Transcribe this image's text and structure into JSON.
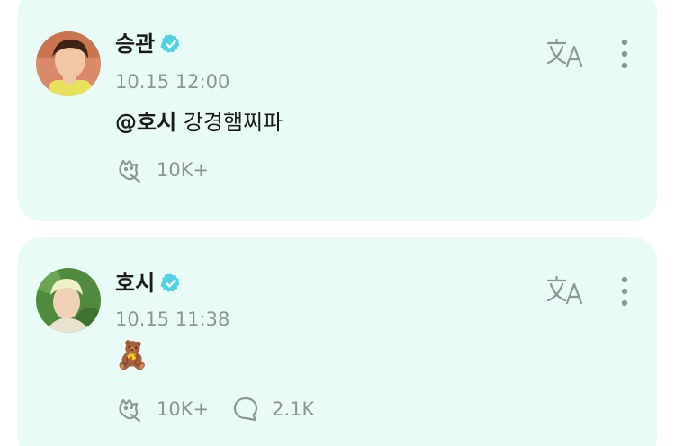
{
  "posts": [
    {
      "author": "승관",
      "verified": true,
      "time": "10.15 12:00",
      "mention": "@호시",
      "text": "강경햄찌파",
      "likes": "10K+",
      "comments": null,
      "icons": [
        "avatar",
        "verified-badge-icon",
        "translate-icon",
        "more-options-icon",
        "like-icon"
      ]
    },
    {
      "author": "호시",
      "verified": true,
      "time": "10.15 11:38",
      "mention": "",
      "text": "🧸",
      "likes": "10K+",
      "comments": "2.1K",
      "icons": [
        "avatar",
        "verified-badge-icon",
        "translate-icon",
        "more-options-icon",
        "like-icon",
        "comment-icon"
      ]
    }
  ],
  "colors": {
    "card_background": "#e8fbf7",
    "verified_badge": "#4fd3e3",
    "muted_text": "#8c9694",
    "primary_text": "#1a1a1a"
  }
}
